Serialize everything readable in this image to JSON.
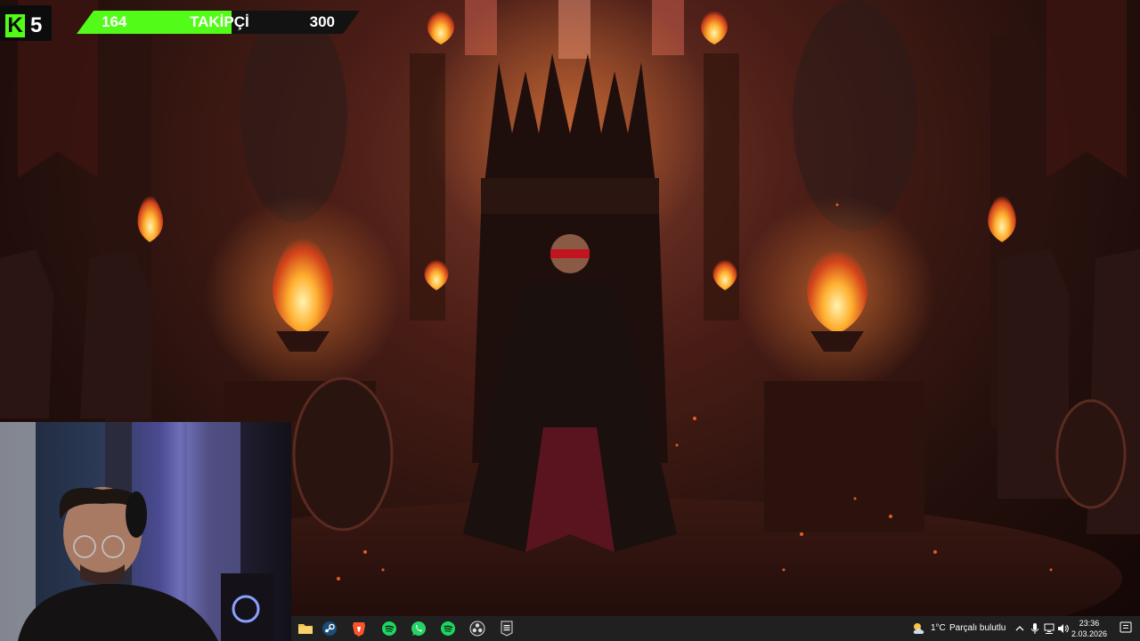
{
  "follower_goal": {
    "platform_logo": "K",
    "platform_number": "5",
    "current": "164",
    "label": "TAKİPÇİ",
    "target": "300",
    "progress": 0.547,
    "accent_color": "#53fc18"
  },
  "taskbar": {
    "apps": [
      {
        "name": "file-explorer-icon"
      },
      {
        "name": "steam-icon"
      },
      {
        "name": "brave-browser-icon"
      },
      {
        "name": "spotify-icon"
      },
      {
        "name": "whatsapp-icon"
      },
      {
        "name": "spotify-icon"
      },
      {
        "name": "obs-icon"
      },
      {
        "name": "epic-games-icon"
      }
    ],
    "weather": {
      "temp": "1°C",
      "description": "Parçalı bulutlu",
      "icon": "partly-cloudy-icon"
    },
    "tray": {
      "icons": [
        "chevron-up-icon",
        "microphone-icon",
        "network-icon",
        "volume-icon"
      ]
    },
    "clock": {
      "time": "23:36",
      "date": "2.03.2026"
    }
  }
}
